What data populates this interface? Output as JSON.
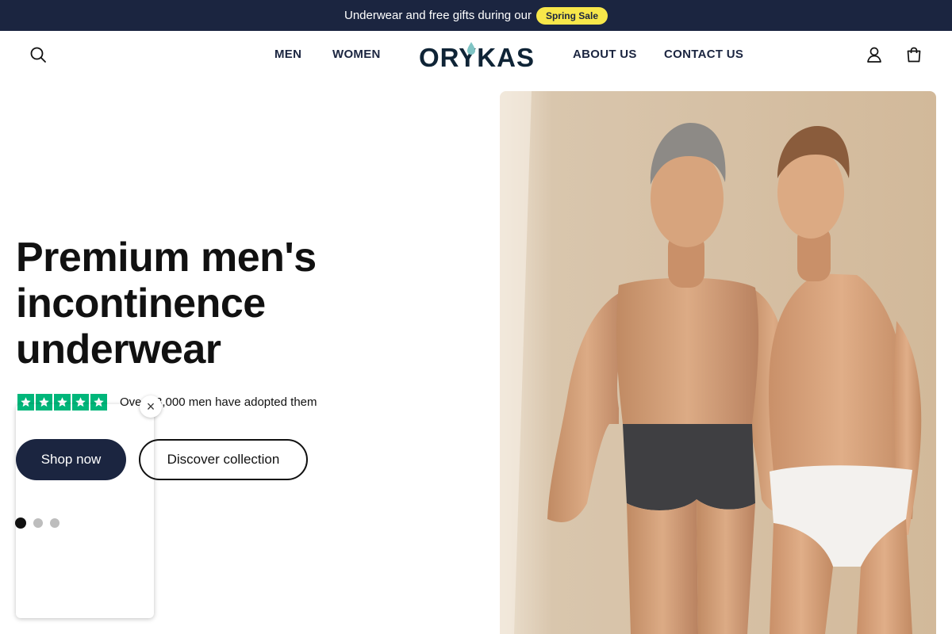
{
  "announcement": {
    "text": "Underwear and free gifts during our",
    "badge": "Spring Sale"
  },
  "header": {
    "logo_text": "ORYKAS",
    "nav_left": [
      "MEN",
      "WOMEN"
    ],
    "nav_right": [
      "ABOUT US",
      "CONTACT US"
    ],
    "icons": [
      "search-icon",
      "account-icon",
      "cart-icon"
    ]
  },
  "hero": {
    "title": "Premium men's incontinence underwear",
    "rating_text": "Over 23,000 men have adopted them",
    "rating_stars": 5,
    "primary_button": "Shop now",
    "secondary_button": "Discover collection",
    "slide_count": 3,
    "active_slide": 1
  },
  "popup": {
    "close_label": "×"
  },
  "colors": {
    "navy": "#1b2540",
    "sale_yellow": "#f7e74a",
    "trustpilot_green": "#00b67a",
    "logo_drop": "#7fc4c4"
  }
}
